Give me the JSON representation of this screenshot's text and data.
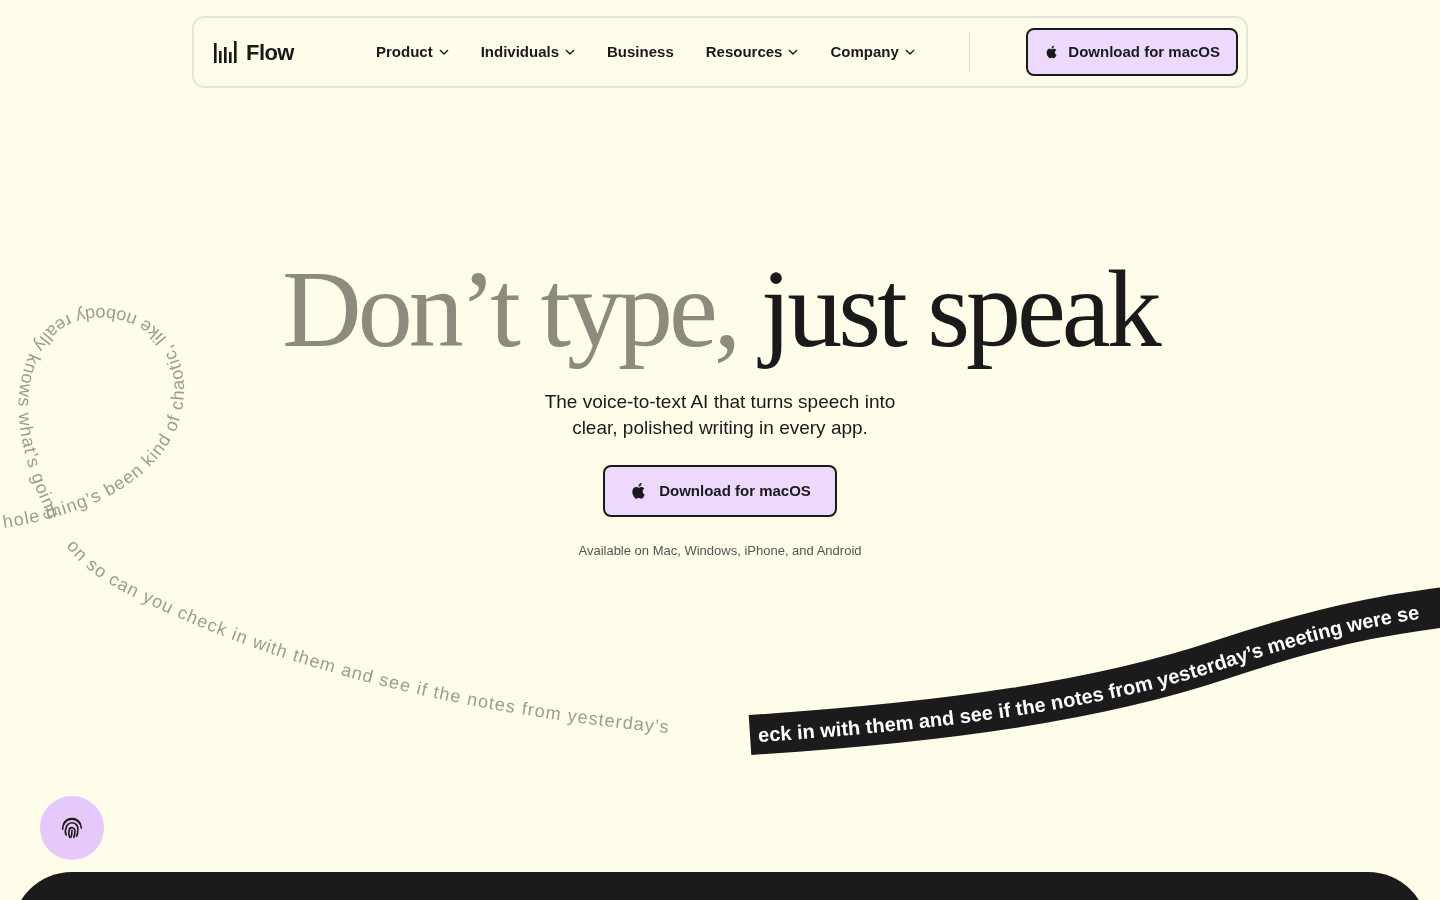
{
  "nav": {
    "logo": "Flow",
    "items": [
      {
        "label": "Product",
        "has_menu": true
      },
      {
        "label": "Individuals",
        "has_menu": true
      },
      {
        "label": "Business",
        "has_menu": false
      },
      {
        "label": "Resources",
        "has_menu": true
      },
      {
        "label": "Company",
        "has_menu": true
      }
    ],
    "cta": "Download for macOS"
  },
  "hero": {
    "headline_muted": "Don’t type,",
    "headline_strong": "just speak",
    "subtitle": "The voice-to-text AI that turns speech into clear, polished writing in every app.",
    "cta": "Download for macOS",
    "availability": "Available on Mac, Windows, iPhone, and Android"
  },
  "transcript": {
    "loop_text": "hole thing’s been kind of chaotic, like nobody really knows what’s going",
    "tail_text": "on so can you check in with them and see if the notes from yesterday’s",
    "ribbon_text": "eck in with them and see if the notes from yesterday’s meeting were se"
  }
}
